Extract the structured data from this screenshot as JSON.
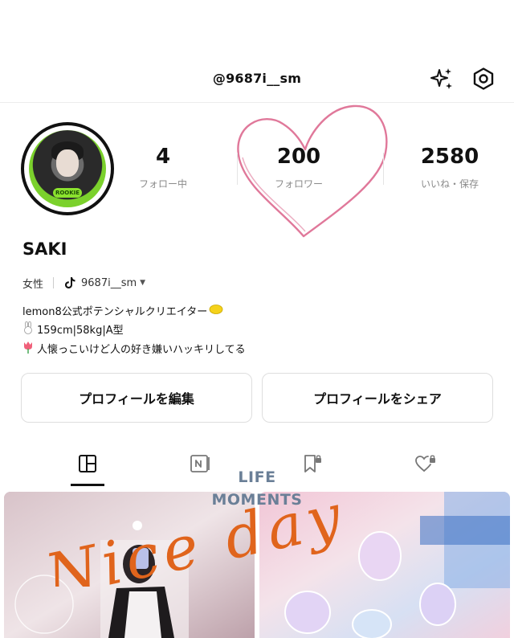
{
  "header": {
    "username": "@9687i__sm"
  },
  "profile": {
    "name": "SAKI",
    "gender": "女性",
    "tiktok_handle": "9687i__sm",
    "avatar_badge": "ROOKIE"
  },
  "stats": {
    "following": {
      "value": "4",
      "label": "フォロー中"
    },
    "followers": {
      "value": "200",
      "label": "フォロワー"
    },
    "likes": {
      "value": "2580",
      "label": "いいね・保存"
    }
  },
  "bio": [
    "lemon8公式ポテンシャルクリエイター",
    "159cm|58kg|A型",
    "人懐っこいけど人の好き嫌いハッキリしてる"
  ],
  "buttons": {
    "edit": "プロフィールを編集",
    "share": "プロフィールをシェア"
  },
  "overlay": {
    "life": "LIFE",
    "moments": "MOMENTS",
    "nice_day": "Nice day"
  },
  "colors": {
    "heart_doodle": "#e0789a",
    "nice_day_text": "#e0641c",
    "life_moments_text": "#6a7f97"
  }
}
